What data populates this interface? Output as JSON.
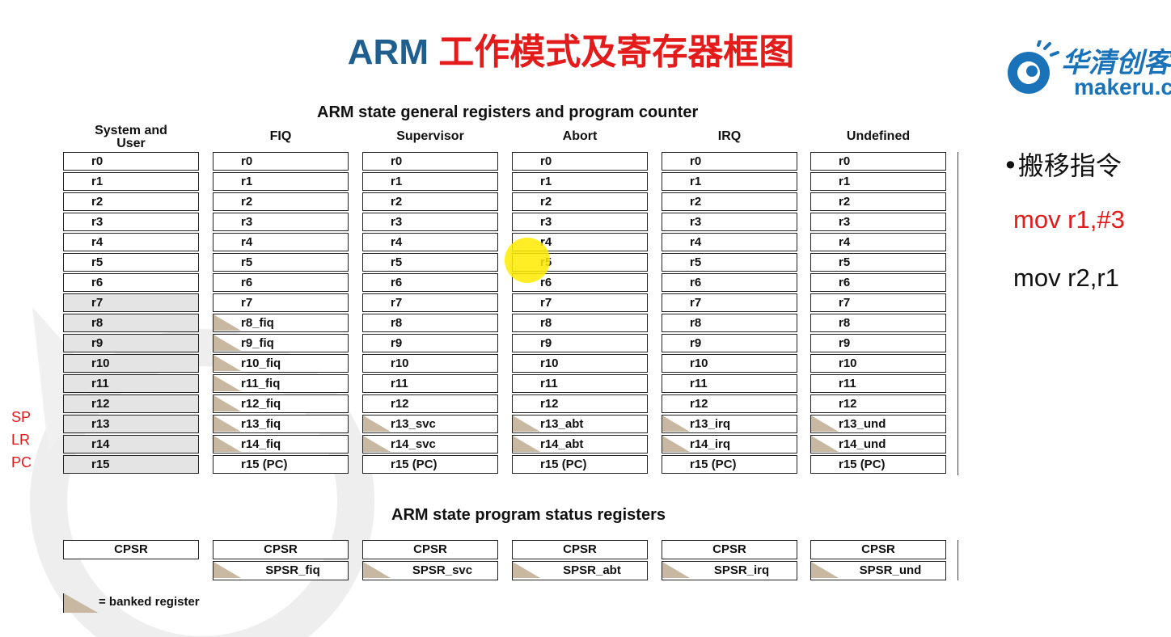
{
  "title": {
    "en": "ARM ",
    "cn": "工作模式及寄存器框图"
  },
  "logo": {
    "cn": "华清创客",
    "en": "makeru.c"
  },
  "general_heading": "ARM state general registers and program counter",
  "psr_heading": "ARM state program status registers",
  "modes": [
    {
      "name": "System and\nUser",
      "regs": [
        "r0",
        "r1",
        "r2",
        "r3",
        "r4",
        "r5",
        "r6",
        "r7",
        "r8",
        "r9",
        "r10",
        "r11",
        "r12",
        "r13",
        "r14",
        "r15"
      ],
      "banked": [],
      "psr": [
        "CPSR"
      ]
    },
    {
      "name": "FIQ",
      "regs": [
        "r0",
        "r1",
        "r2",
        "r3",
        "r4",
        "r5",
        "r6",
        "r7",
        "r8_fiq",
        "r9_fiq",
        "r10_fiq",
        "r11_fiq",
        "r12_fiq",
        "r13_fiq",
        "r14_fiq",
        "r15 (PC)"
      ],
      "banked": [
        8,
        9,
        10,
        11,
        12,
        13,
        14
      ],
      "psr": [
        "CPSR",
        "SPSR_fiq"
      ]
    },
    {
      "name": "Supervisor",
      "regs": [
        "r0",
        "r1",
        "r2",
        "r3",
        "r4",
        "r5",
        "r6",
        "r7",
        "r8",
        "r9",
        "r10",
        "r11",
        "r12",
        "r13_svc",
        "r14_svc",
        "r15 (PC)"
      ],
      "banked": [
        13,
        14
      ],
      "psr": [
        "CPSR",
        "SPSR_svc"
      ]
    },
    {
      "name": "Abort",
      "regs": [
        "r0",
        "r1",
        "r2",
        "r3",
        "r4",
        "r5",
        "r6",
        "r7",
        "r8",
        "r9",
        "r10",
        "r11",
        "r12",
        "r13_abt",
        "r14_abt",
        "r15 (PC)"
      ],
      "banked": [
        13,
        14
      ],
      "psr": [
        "CPSR",
        "SPSR_abt"
      ]
    },
    {
      "name": "IRQ",
      "regs": [
        "r0",
        "r1",
        "r2",
        "r3",
        "r4",
        "r5",
        "r6",
        "r7",
        "r8",
        "r9",
        "r10",
        "r11",
        "r12",
        "r13_irq",
        "r14_irq",
        "r15 (PC)"
      ],
      "banked": [
        13,
        14
      ],
      "psr": [
        "CPSR",
        "SPSR_irq"
      ]
    },
    {
      "name": "Undefined",
      "regs": [
        "r0",
        "r1",
        "r2",
        "r3",
        "r4",
        "r5",
        "r6",
        "r7",
        "r8",
        "r9",
        "r10",
        "r11",
        "r12",
        "r13_und",
        "r14_und",
        "r15 (PC)"
      ],
      "banked": [
        13,
        14
      ],
      "psr": [
        "CPSR",
        "SPSR_und"
      ]
    }
  ],
  "legend": "= banked register",
  "side_labels": [
    "SP",
    "LR",
    "PC"
  ],
  "notes": {
    "bullet": "•搬移指令",
    "code1": "mov  r1,#3",
    "code2": "mov  r2,r1"
  },
  "colors": {
    "title_blue": "#1f5f8f",
    "title_red": "#e31b1b",
    "banked": "#c8b8a2",
    "logo": "#1a73b8"
  }
}
